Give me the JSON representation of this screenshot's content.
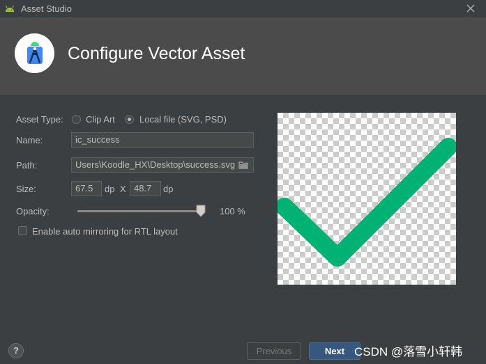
{
  "window": {
    "title": "Asset Studio"
  },
  "header": {
    "title": "Configure Vector Asset"
  },
  "form": {
    "asset_type_label": "Asset Type:",
    "asset_type_options": [
      "Clip Art",
      "Local file (SVG, PSD)"
    ],
    "asset_type_selected": "Local file (SVG, PSD)",
    "name_label": "Name:",
    "name_value": "ic_success",
    "path_label": "Path:",
    "path_value": "Users\\Koodle_HX\\Desktop\\success.svg",
    "size_label": "Size:",
    "width_value": "67.5",
    "height_value": "48.7",
    "unit_dp": "dp",
    "size_separator": "X",
    "opacity_label": "Opacity:",
    "opacity_value": "100 %",
    "opacity_fraction": 1.0,
    "rtl_label": "Enable auto mirroring for RTL layout",
    "rtl_checked": false
  },
  "preview": {
    "icon": "check-mark-icon",
    "icon_color": "#00b274"
  },
  "footer": {
    "help_label": "?",
    "previous_label": "Previous",
    "next_label": "Next",
    "watermark": "CSDN @落雪小轩韩"
  },
  "colors": {
    "background": "#3c3f41",
    "header_background": "#4b4b4b",
    "accent_button": "#365880",
    "android_green": "#a4c639"
  }
}
